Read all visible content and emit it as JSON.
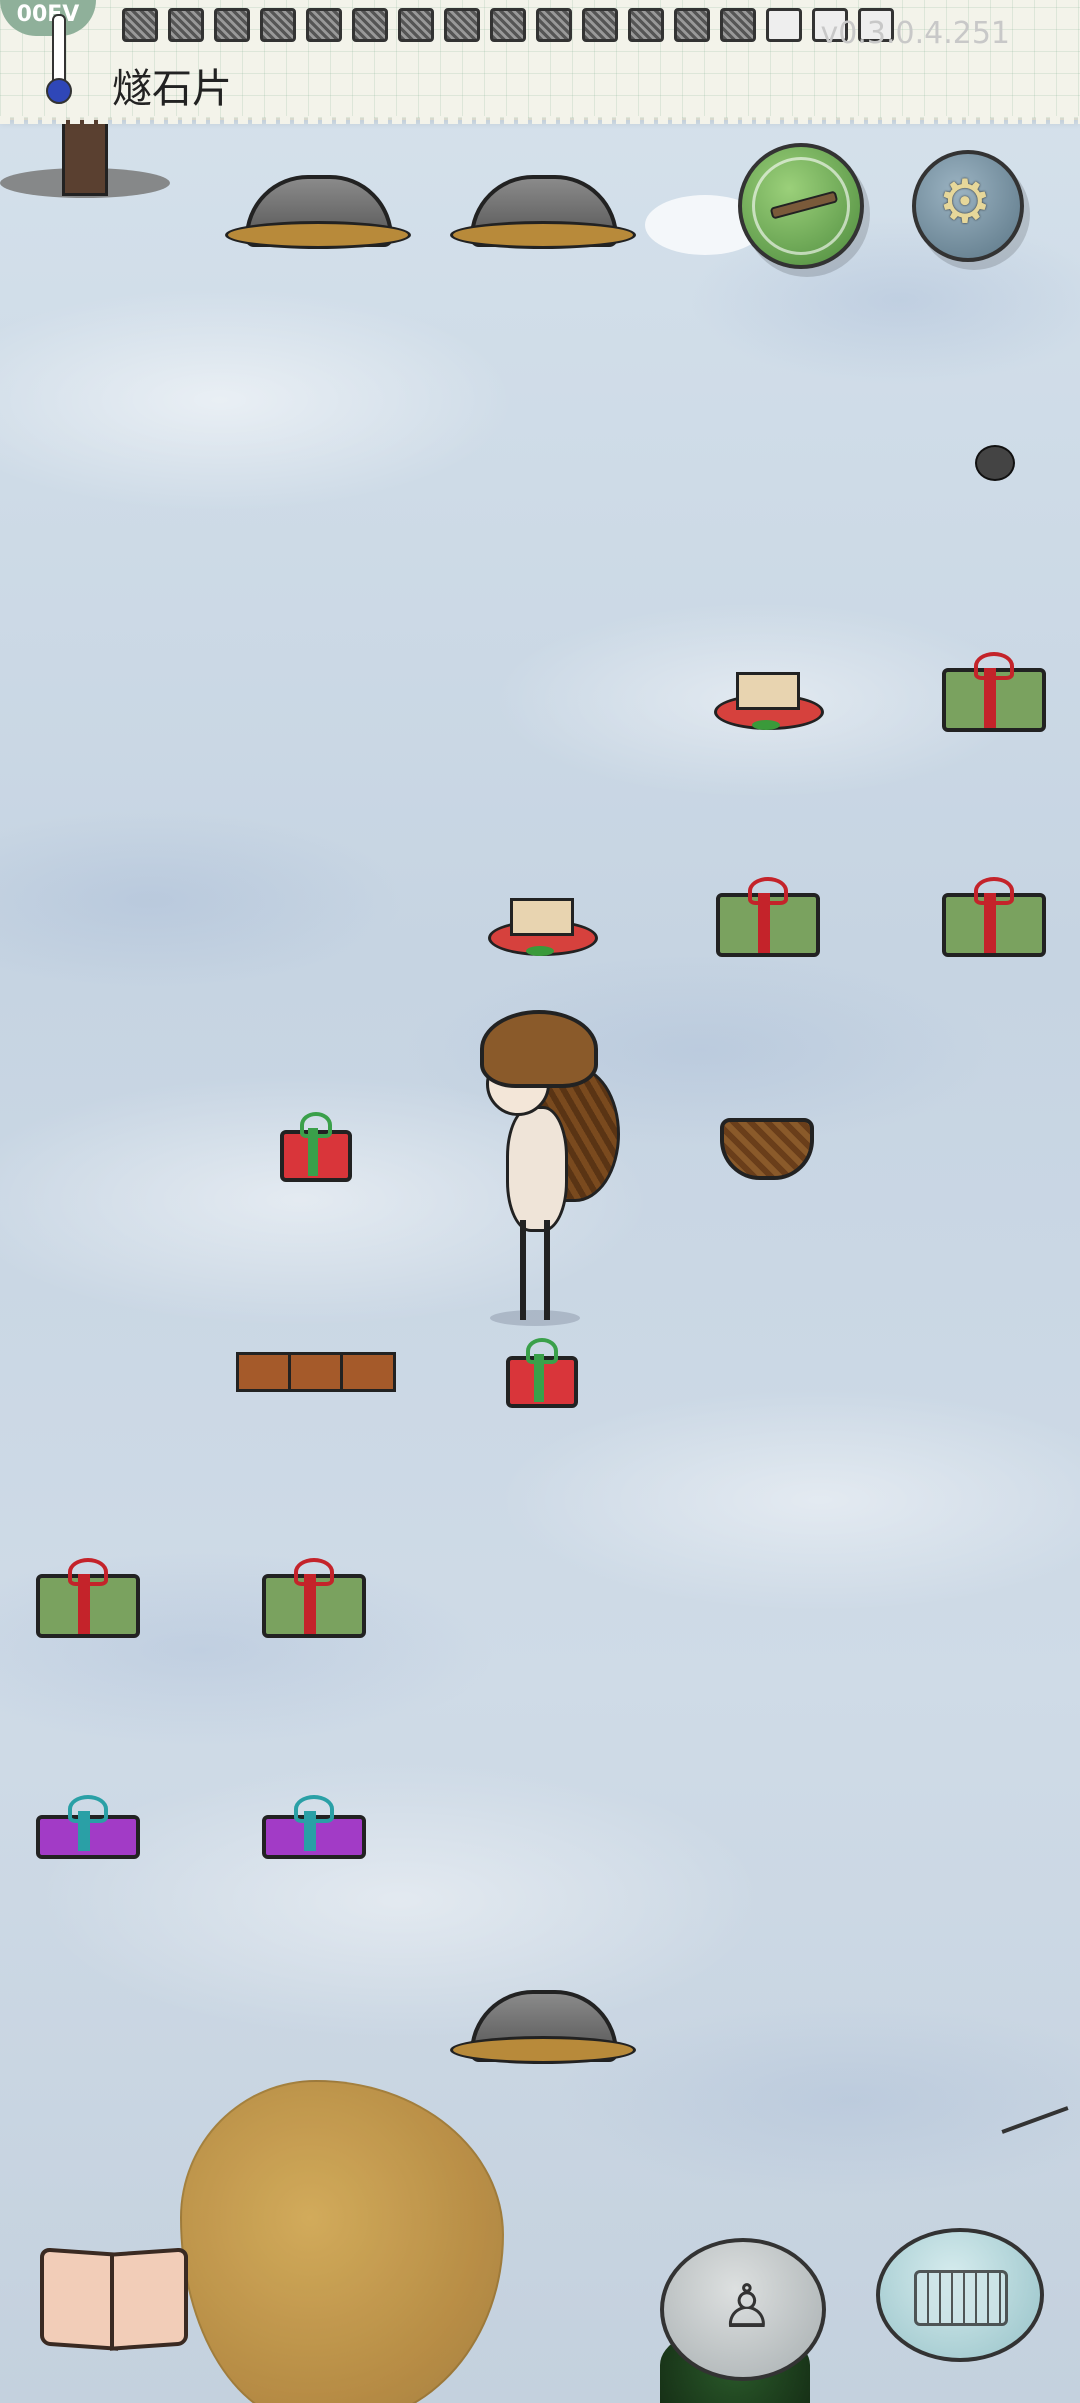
{
  "hud": {
    "temperature_label": "00EV",
    "selected_item_label": "燧石片",
    "version_text": "v0.3.0.4.251"
  },
  "buttons": {
    "map": "map-compass",
    "settings": "settings",
    "journal": "journal",
    "emote": "puppet-emote",
    "chat": "keyboard-chat"
  },
  "colors": {
    "snow": "#cfdbe7",
    "map_button": "#4c8a3c",
    "settings_button": "#5b7686",
    "chat_button": "#96c2c8"
  },
  "world_objects": {
    "rocks": 3,
    "green_gifts": 5,
    "red_gifts": 2,
    "purple_gifts": 2,
    "cake_trays": 2,
    "basket": 1,
    "planks": 1
  }
}
